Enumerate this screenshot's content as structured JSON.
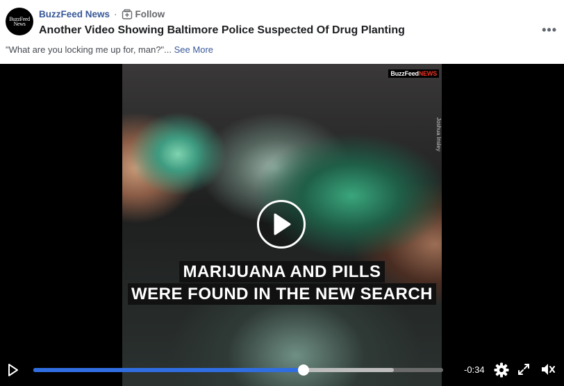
{
  "post": {
    "avatar_line1": "BuzzFeed",
    "avatar_line2": "News",
    "page_name": "BuzzFeed News",
    "separator": "·",
    "follow_label": "Follow",
    "title": "Another Video Showing Baltimore Police Suspected Of Drug Planting",
    "description": "\"What are you locking me up for, man?\"...",
    "see_more": "See More",
    "more_icon": "•••"
  },
  "video": {
    "logo_brand": "BuzzFeed",
    "logo_news": "NEWS",
    "credit": "Joshua Insley",
    "caption_line1": "MARIJUANA AND PILLS",
    "caption_line2": "WERE FOUND IN THE NEW SEARCH",
    "time_remaining": "-0:34",
    "progress_fraction": 0.66,
    "buffered_fraction": 0.88,
    "accent_color": "#2f6de1"
  }
}
